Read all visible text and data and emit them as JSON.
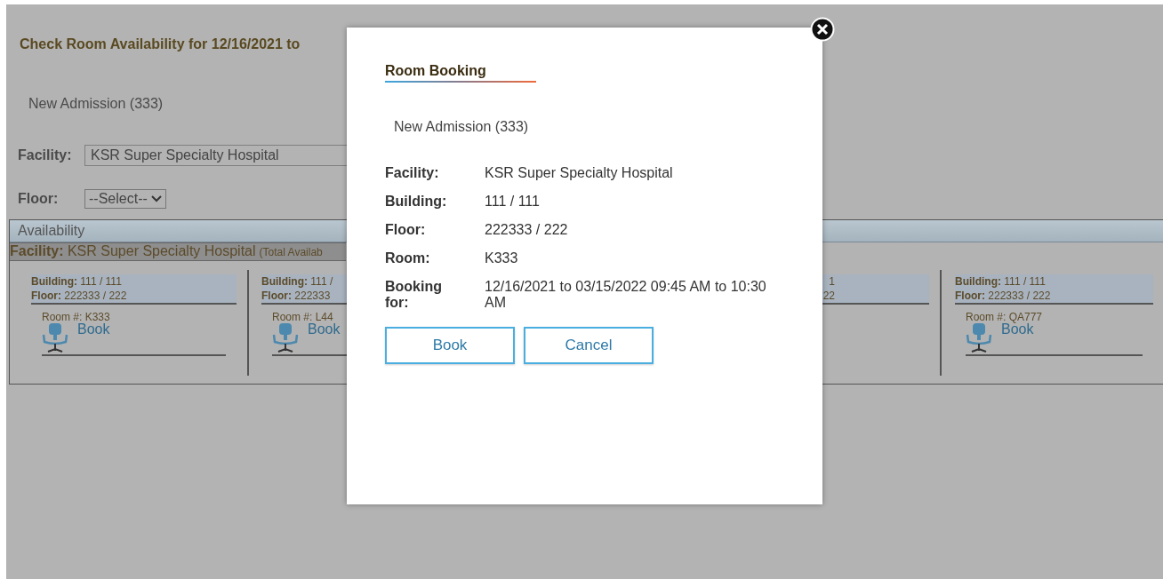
{
  "page": {
    "title": "Check Room Availability for 12/16/2021 to",
    "patient": "New Admission (333)",
    "facility_label": "Facility:",
    "facility_value": "KSR Super Specialty Hospital",
    "floor_label": "Floor:",
    "floor_select": "--Select--"
  },
  "availability": {
    "header": "Availability",
    "facility": "**Facility:** KSR Super Specialty Hospital",
    "total": "(Total Availab",
    "rooms": [
      {
        "kind": "full",
        "building": "**Building:** 111 / 111",
        "floor": "**Floor:** 222333 / 222",
        "room": "Room #: K333",
        "action": "Book"
      },
      {
        "kind": "cut_right",
        "building": "**Building:** 111 /",
        "floor": "**Floor:** 222333",
        "room": "Room #: L44",
        "action": "Book"
      },
      {
        "kind": "cut_left",
        "building": "1",
        "floor": "22"
      },
      {
        "kind": "full",
        "building": "**Building:** 111 / 111",
        "floor": "**Floor:** 222333 / 222",
        "room": "Room #: QA777",
        "action": "Book"
      }
    ]
  },
  "modal": {
    "title": "Room Booking",
    "patient": "New Admission (333)",
    "details": [
      {
        "label": "Facility:",
        "value": "KSR Super Specialty Hospital"
      },
      {
        "label": "Building:",
        "value": "111 / 111"
      },
      {
        "label": "Floor:",
        "value": "222333 / 222"
      },
      {
        "label": "Room:",
        "value": "K333"
      },
      {
        "label": "Booking for:",
        "value": "12/16/2021 to 03/15/2022 09:45 AM to 10:30 AM"
      }
    ],
    "buttons": [
      "Book",
      "Cancel"
    ]
  }
}
